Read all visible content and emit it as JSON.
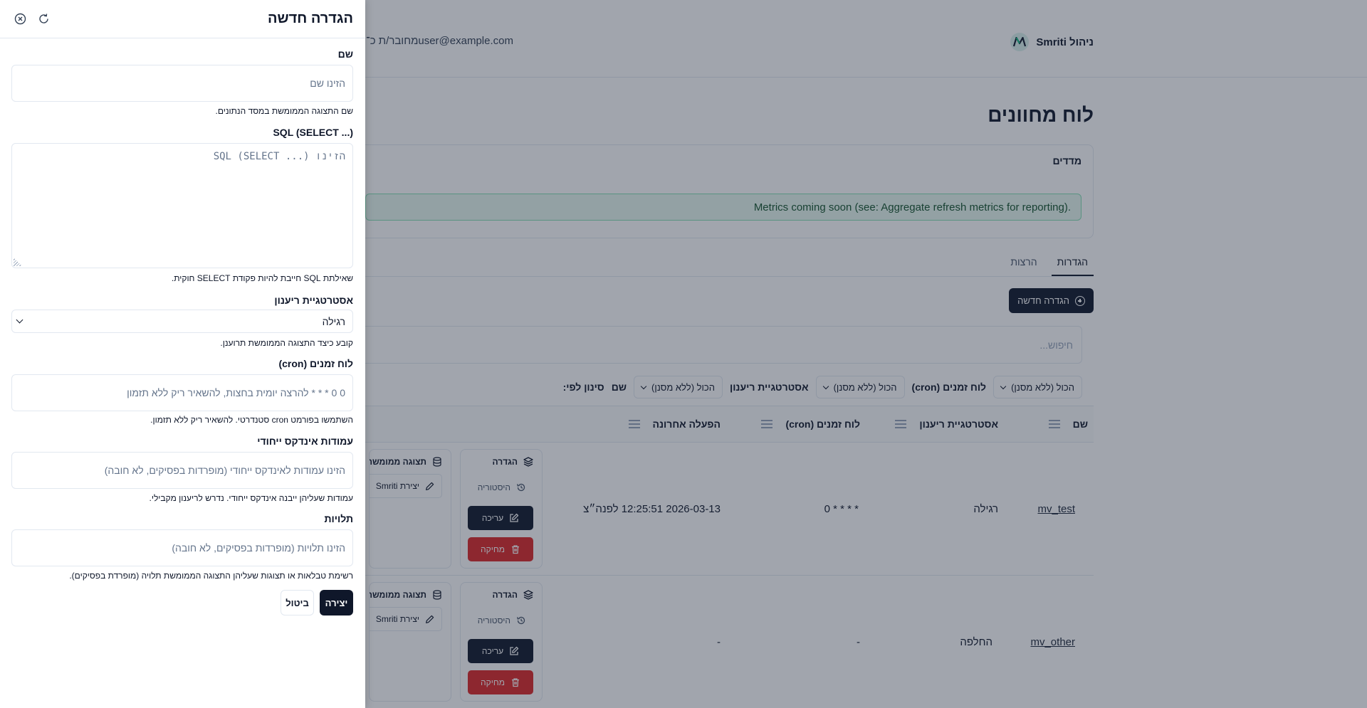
{
  "app": {
    "brand": "ניהול Smriti",
    "user_text": "מחובר/ת כ־user@example.com"
  },
  "page": {
    "title": "לוח מחוונים",
    "metrics_title": "מדדים",
    "metrics_alert": "Metrics coming soon (see: Aggregate refresh metrics for reporting).",
    "tabs": [
      "הגדרות",
      "הרצות"
    ],
    "new_button": "הגדרה חדשה",
    "search_placeholder": "חיפוש...",
    "filter_by": "סינון לפי:",
    "filters": [
      {
        "label": "שם",
        "value": "הכול (ללא מסנן)"
      },
      {
        "label": "אסטרטגיית ריענון",
        "value": "הכול (ללא מסנן)"
      },
      {
        "label": "לוח זמנים (cron)",
        "value": "הכול (ללא מסנן)"
      }
    ]
  },
  "table": {
    "headers": [
      "שם",
      "אסטרטגיית ריענון",
      "לוח זמנים (cron)",
      "הפעלה אחרונה"
    ],
    "rows": [
      {
        "name": "mv_test",
        "strategy": "רגילה",
        "cron": "0 * * * *",
        "last_run": "2026-03-13 12:25:51 לפנה״צ"
      },
      {
        "name": "mv_other",
        "strategy": "החלפה",
        "cron": "-",
        "last_run": "-"
      }
    ],
    "actions": {
      "definition": "הגדרה",
      "history": "היסטוריה",
      "edit": "עריכה",
      "delete": "מחיקה",
      "mv_header": "תצוגה ממומשת",
      "mv_create": "יצירת Smriti"
    }
  },
  "drawer": {
    "title": "הגדרה חדשה",
    "name": {
      "label": "שם",
      "placeholder": "הזינו שם",
      "help": "שם התצוגה הממומשת במסד הנתונים."
    },
    "sql": {
      "label": "SQL (SELECT ...)",
      "placeholder": "הזינו SQL (SELECT ...)",
      "help": "שאילתת SQL חייבת להיות פקודת SELECT חוקית."
    },
    "strategy": {
      "label": "אסטרטגיית ריענון",
      "value": "רגילה",
      "help": "קובע כיצד התצוגה הממומשת תרוענן."
    },
    "cron": {
      "label": "לוח זמנים (cron)",
      "placeholder": "0 0 * * * להרצה יומית בחצות, להשאיר ריק ללא תזמון",
      "help": "השתמשו בפורמט cron סטנדרטי. להשאיר ריק ללא תזמון."
    },
    "unique_index": {
      "label": "עמודות אינדקס ייחודי",
      "placeholder": "הזינו עמודות לאינדקס ייחודי (מופרדות בפסיקים, לא חובה)",
      "help": "עמודות שעליהן ייבנה אינדקס ייחודי. נדרש לריענון מקבילי."
    },
    "dependencies": {
      "label": "תלויות",
      "placeholder": "הזינו תלויות (מופרדות בפסיקים, לא חובה)",
      "help": "רשימת טבלאות או תצוגות שעליהן התצוגה הממומשת תלויה (מופרדת בפסיקים)."
    },
    "create_button": "יצירה",
    "cancel_button": "ביטול"
  },
  "colors": {
    "primary": "#0f172a",
    "danger": "#dc2626",
    "alert_bg": "#e7f8ef",
    "alert_border": "#86e0b5",
    "overlay": "rgba(30,41,59,0.42)"
  }
}
